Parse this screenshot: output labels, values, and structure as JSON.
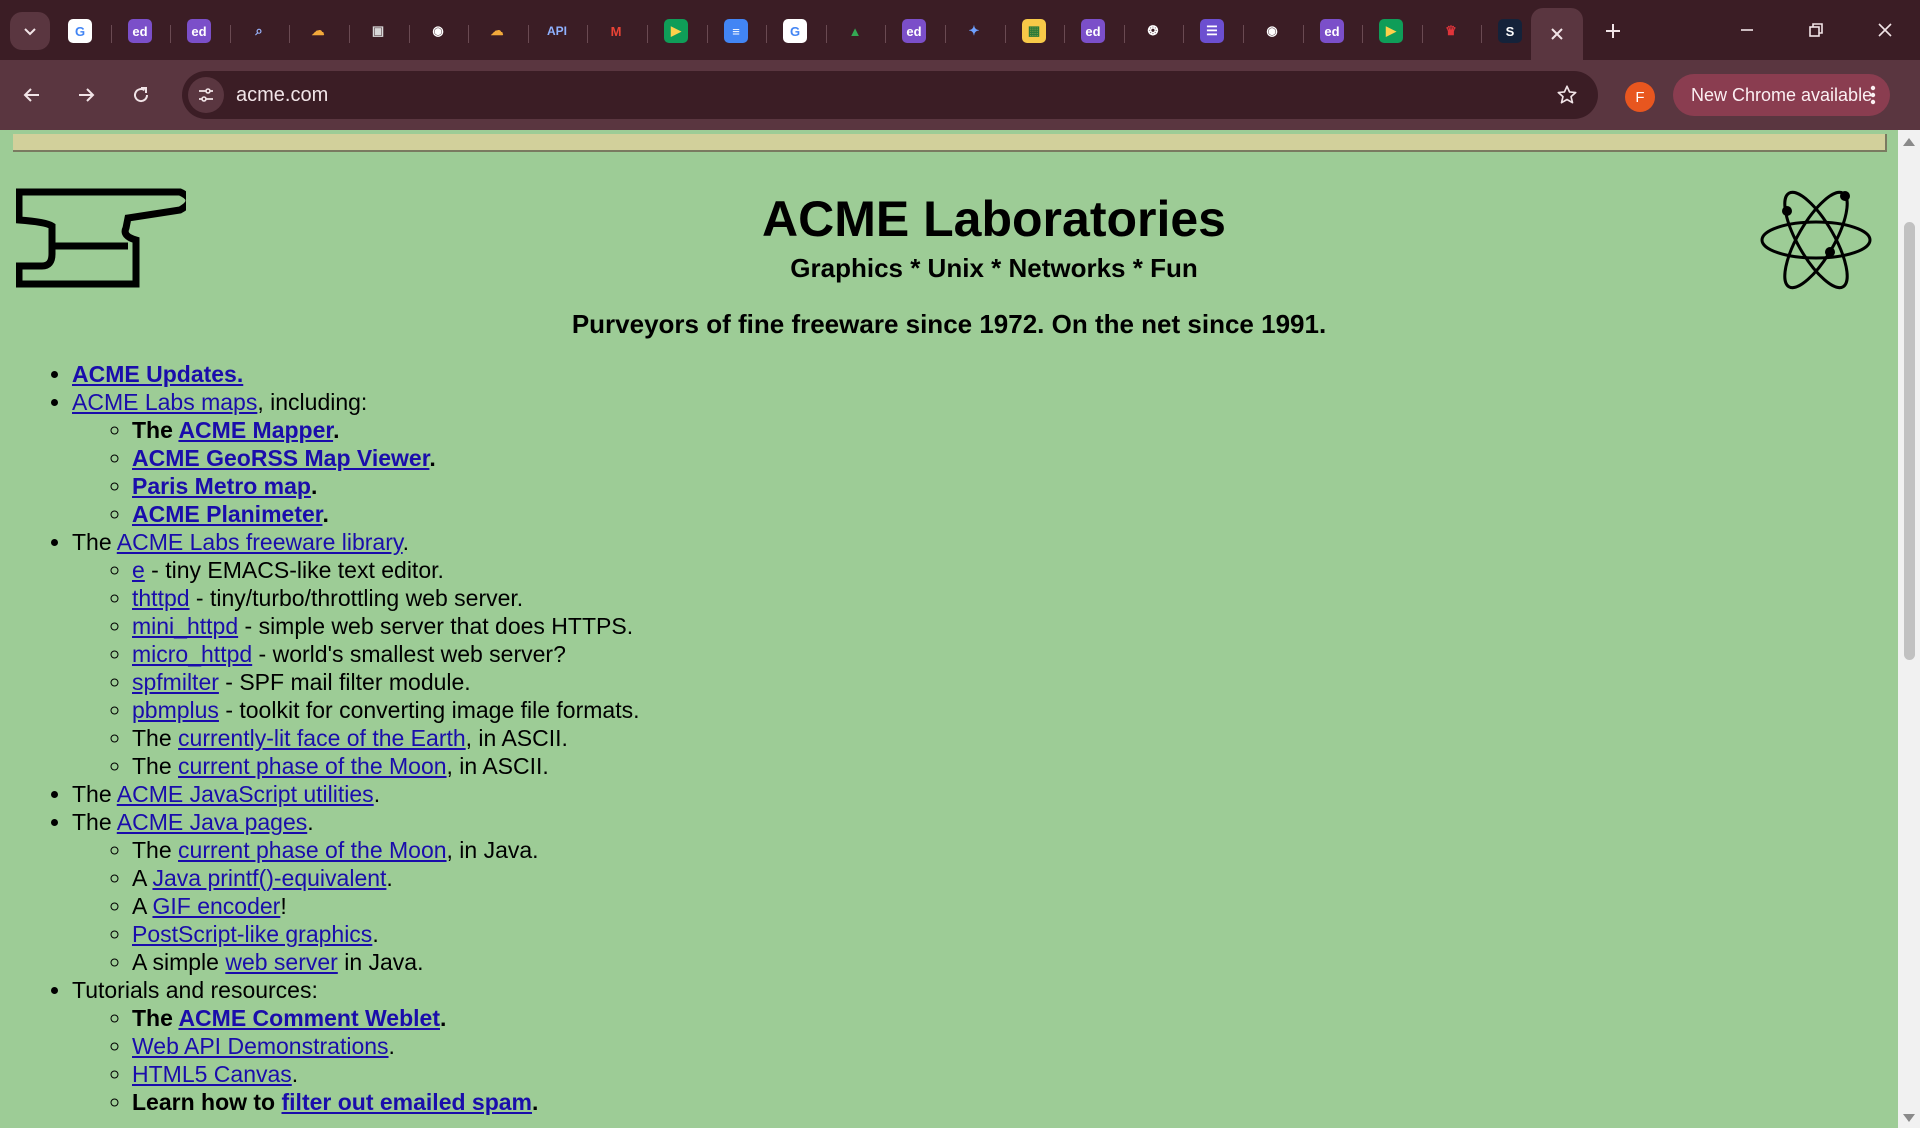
{
  "browser": {
    "tabs_icons": [
      {
        "name": "google-icon",
        "label": "G",
        "bg": "#ffffff",
        "fg": "#4285f4"
      },
      {
        "name": "ed-icon",
        "label": "ed",
        "bg": "#7b4fc9",
        "fg": "#ffffff"
      },
      {
        "name": "ed-icon",
        "label": "ed",
        "bg": "#7b4fc9",
        "fg": "#ffffff"
      },
      {
        "name": "search-doc-icon",
        "label": "⌕",
        "bg": "transparent",
        "fg": "#9bb6ff"
      },
      {
        "name": "cloud-icon",
        "label": "☁",
        "bg": "transparent",
        "fg": "#f2a93b"
      },
      {
        "name": "terminal-icon",
        "label": "▣",
        "bg": "transparent",
        "fg": "#d8d8d8"
      },
      {
        "name": "github-icon",
        "label": "◉",
        "bg": "transparent",
        "fg": "#ffffff"
      },
      {
        "name": "cloud-icon",
        "label": "☁",
        "bg": "transparent",
        "fg": "#f2a93b"
      },
      {
        "name": "api-icon",
        "label": "API",
        "bg": "transparent",
        "fg": "#8fb2ff"
      },
      {
        "name": "gmail-icon",
        "label": "M",
        "bg": "transparent",
        "fg": "#ea4335"
      },
      {
        "name": "meet-icon",
        "label": "▶",
        "bg": "#0f9d58",
        "fg": "#ffd04b"
      },
      {
        "name": "docs-icon",
        "label": "≡",
        "bg": "#4285f4",
        "fg": "#ffffff"
      },
      {
        "name": "google-icon",
        "label": "G",
        "bg": "#ffffff",
        "fg": "#4285f4"
      },
      {
        "name": "drive-icon",
        "label": "▲",
        "bg": "transparent",
        "fg": "#34a853"
      },
      {
        "name": "ed-icon",
        "label": "ed",
        "bg": "#7b4fc9",
        "fg": "#ffffff"
      },
      {
        "name": "gemini-icon",
        "label": "✦",
        "bg": "transparent",
        "fg": "#6ea0ff"
      },
      {
        "name": "photo-icon",
        "label": "▦",
        "bg": "#f7c948",
        "fg": "#2a7a3a"
      },
      {
        "name": "ed-icon",
        "label": "ed",
        "bg": "#7b4fc9",
        "fg": "#ffffff"
      },
      {
        "name": "openai-icon",
        "label": "❂",
        "bg": "transparent",
        "fg": "#ffffff"
      },
      {
        "name": "list-icon",
        "label": "☰",
        "bg": "#6c4fd0",
        "fg": "#ffffff"
      },
      {
        "name": "github-icon",
        "label": "◉",
        "bg": "transparent",
        "fg": "#ffffff"
      },
      {
        "name": "ed-icon",
        "label": "ed",
        "bg": "#7b4fc9",
        "fg": "#ffffff"
      },
      {
        "name": "meet-icon",
        "label": "▶",
        "bg": "#0f9d58",
        "fg": "#ffd04b"
      },
      {
        "name": "crown-icon",
        "label": "♛",
        "bg": "transparent",
        "fg": "#e0343a"
      },
      {
        "name": "s-icon",
        "label": "S",
        "bg": "#14223a",
        "fg": "#ffffff"
      }
    ],
    "url": "acme.com",
    "avatar_letter": "F",
    "update_label": "New Chrome available"
  },
  "page": {
    "title": "ACME Laboratories",
    "subtitle": "Graphics * Unix * Networks * Fun",
    "tagline": "Purveyors of fine freeware since 1972. On the net since 1991.",
    "updates": "ACME Updates.",
    "maps": {
      "link": "ACME Labs maps",
      "suffix": ", including:",
      "mapper_prefix": "The ",
      "mapper": "ACME Mapper",
      "georss": "ACME GeoRSS Map Viewer",
      "paris": "Paris Metro map",
      "planimeter": "ACME Planimeter",
      "period": "."
    },
    "freeware": {
      "prefix": "The ",
      "link": "ACME Labs freeware library",
      "suffix": ".",
      "items": [
        {
          "link": "e",
          "text": " - tiny EMACS-like text editor."
        },
        {
          "link": "thttpd",
          "text": " - tiny/turbo/throttling web server."
        },
        {
          "link": "mini_httpd",
          "text": " - simple web server that does HTTPS."
        },
        {
          "link": "micro_httpd",
          "text": " - world's smallest web server?"
        },
        {
          "link": "spfmilter",
          "text": " - SPF mail filter module."
        },
        {
          "link": "pbmplus",
          "text": " - toolkit for converting image file formats."
        }
      ],
      "earth_prefix": "The ",
      "earth_link": "currently-lit face of the Earth",
      "earth_suffix": ", in ASCII.",
      "moon_prefix": "The ",
      "moon_link": "current phase of the Moon",
      "moon_suffix": ", in ASCII."
    },
    "js": {
      "prefix": "The ",
      "link": "ACME JavaScript utilities",
      "suffix": "."
    },
    "java": {
      "prefix": "The ",
      "link": "ACME Java pages",
      "suffix": ".",
      "moon_prefix": "The ",
      "moon_link": "current phase of the Moon",
      "moon_suffix": ", in Java.",
      "printf_prefix": "A ",
      "printf_link": "Java printf()-equivalent",
      "printf_suffix": ".",
      "gif_prefix": "A ",
      "gif_link": "GIF encoder",
      "gif_suffix": "!",
      "ps_link": "PostScript-like graphics",
      "ps_suffix": ".",
      "ws_prefix": "A simple ",
      "ws_link": "web server",
      "ws_suffix": " in Java."
    },
    "tutorials": {
      "label": "Tutorials and resources:",
      "comment_prefix": "The ",
      "comment_link": "ACME Comment Weblet",
      "comment_suffix": ".",
      "webapi_link": "Web API Demonstrations",
      "webapi_suffix": ".",
      "canvas_link": "HTML5 Canvas",
      "canvas_suffix": ".",
      "spam_prefix": "Learn how to ",
      "spam_link": "filter out emailed spam",
      "spam_suffix": "."
    }
  }
}
